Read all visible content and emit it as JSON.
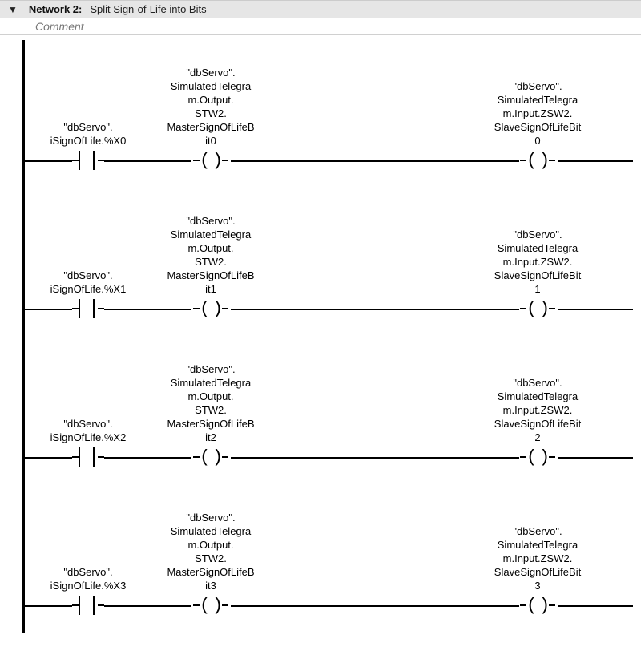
{
  "header": {
    "title": "Network 2:",
    "subtitle": "Split Sign-of-Life into Bits"
  },
  "comment": "Comment",
  "rungs": [
    {
      "contact": "\"dbServo\".\niSignOfLife.%X0",
      "coil1": "\"dbServo\".\nSimulatedTelegra\nm.Output.\nSTW2.\nMasterSignOfLifeB\nit0",
      "coil2": "\"dbServo\".\nSimulatedTelegra\nm.Input.ZSW2.\nSlaveSignOfLifeBit\n0"
    },
    {
      "contact": "\"dbServo\".\niSignOfLife.%X1",
      "coil1": "\"dbServo\".\nSimulatedTelegra\nm.Output.\nSTW2.\nMasterSignOfLifeB\nit1",
      "coil2": "\"dbServo\".\nSimulatedTelegra\nm.Input.ZSW2.\nSlaveSignOfLifeBit\n1"
    },
    {
      "contact": "\"dbServo\".\niSignOfLife.%X2",
      "coil1": "\"dbServo\".\nSimulatedTelegra\nm.Output.\nSTW2.\nMasterSignOfLifeB\nit2",
      "coil2": "\"dbServo\".\nSimulatedTelegra\nm.Input.ZSW2.\nSlaveSignOfLifeBit\n2"
    },
    {
      "contact": "\"dbServo\".\niSignOfLife.%X3",
      "coil1": "\"dbServo\".\nSimulatedTelegra\nm.Output.\nSTW2.\nMasterSignOfLifeB\nit3",
      "coil2": "\"dbServo\".\nSimulatedTelegra\nm.Input.ZSW2.\nSlaveSignOfLifeBit\n3"
    }
  ]
}
